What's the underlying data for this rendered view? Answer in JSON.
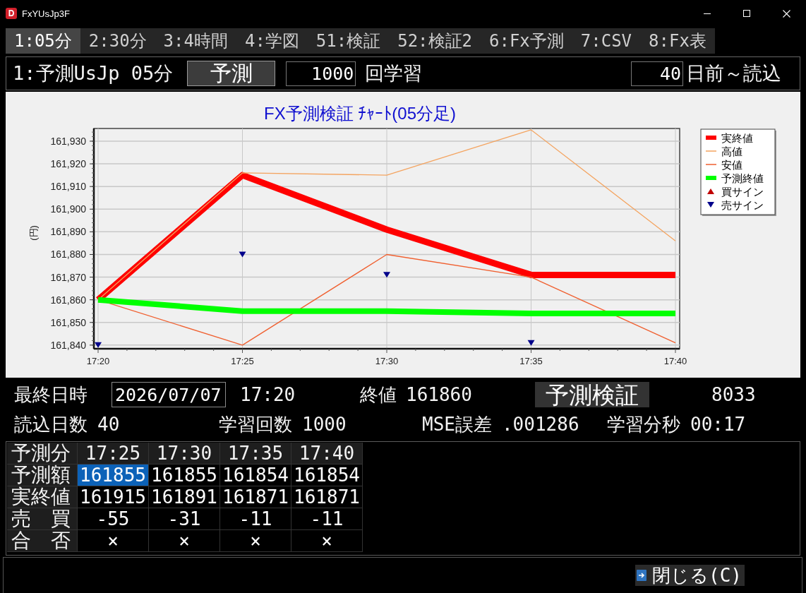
{
  "window": {
    "app_icon": "D",
    "title": "FxYUsJp3F"
  },
  "tabs": [
    {
      "label": "1:05分",
      "selected": true
    },
    {
      "label": "2:30分",
      "selected": false
    },
    {
      "label": "3:4時間",
      "selected": false
    },
    {
      "label": "4:学図",
      "selected": false
    },
    {
      "label": "51:検証",
      "selected": false
    },
    {
      "label": "52:検証2",
      "selected": false
    },
    {
      "label": "6:Fx予測",
      "selected": false
    },
    {
      "label": "7:CSV",
      "selected": false
    },
    {
      "label": "8:Fx表",
      "selected": false
    }
  ],
  "toolbar": {
    "mode": "1:予測UsJp 05分",
    "predict_button": "予測",
    "iterations": {
      "value": "1000",
      "label": "回学習"
    },
    "days": {
      "value": "40",
      "label": "日前～読込"
    }
  },
  "chart": {
    "chart_data": {
      "type": "line",
      "title": "FX予測検証 ﾁｬｰﾄ(05分足)",
      "ylabel": "(円)",
      "categories": [
        "17:20",
        "17:25",
        "17:30",
        "17:35",
        "17:40"
      ],
      "ylim": [
        161838.4,
        161935.6
      ],
      "yticks": [
        {
          "value": 161840,
          "label": "161,840"
        },
        {
          "value": 161850,
          "label": "161,850"
        },
        {
          "value": 161860,
          "label": "161,860"
        },
        {
          "value": 161870,
          "label": "161,870"
        },
        {
          "value": 161880,
          "label": "161,880"
        },
        {
          "value": 161890,
          "label": "161,890"
        },
        {
          "value": 161900,
          "label": "161,900"
        },
        {
          "value": 161910,
          "label": "161,910"
        },
        {
          "value": 161920,
          "label": "161,920"
        },
        {
          "value": 161930,
          "label": "161,930"
        }
      ],
      "grid": true,
      "legend": true,
      "series": [
        {
          "name": "実終値",
          "color": "#ff0000",
          "type": "line",
          "values": [
            161860,
            161915,
            161891,
            161871,
            161871
          ]
        },
        {
          "name": "高値",
          "color": "#f4a460",
          "type": "line",
          "values": [
            161860,
            161916,
            161915,
            161935,
            161886
          ]
        },
        {
          "name": "安値",
          "color": "#f06030",
          "type": "line",
          "values": [
            161860,
            161840,
            161880,
            161870,
            161841
          ]
        },
        {
          "name": "予測終値",
          "color": "#00ff00",
          "type": "line",
          "values": [
            161860,
            161855,
            161855,
            161854,
            161854
          ]
        },
        {
          "name": "買サイン",
          "color": "#c00000",
          "type": "scatter",
          "marker": "triangle-up",
          "values": [
            null,
            null,
            null,
            null,
            null
          ]
        },
        {
          "name": "売サイン",
          "color": "#00008b",
          "type": "scatter",
          "marker": "triangle-down",
          "values": [
            161840,
            161880,
            161871,
            161841,
            null
          ]
        }
      ]
    }
  },
  "summary": {
    "last_datetime": {
      "label": "最終日時",
      "date": "2026/07/07",
      "time": "17:20"
    },
    "close": {
      "label": "終値",
      "value": "161860"
    },
    "verify_button": "予測検証",
    "count": "8033",
    "stats": [
      {
        "label": "読込日数",
        "value": "40"
      },
      {
        "label": "学習回数",
        "value": "1000"
      },
      {
        "label": "MSE誤差",
        "value": ".001286"
      },
      {
        "label": "学習分秒",
        "value": "00:17"
      }
    ]
  },
  "forecast_table": {
    "header": {
      "label": "予測分",
      "cells": [
        "17:25",
        "17:30",
        "17:35",
        "17:40"
      ]
    },
    "rows": [
      {
        "label": "予測額",
        "cells": [
          {
            "text": "161855",
            "selected": true
          },
          {
            "text": "161855",
            "selected": false
          },
          {
            "text": "161854",
            "selected": false
          },
          {
            "text": "161854",
            "selected": false
          }
        ]
      },
      {
        "label": "実終値",
        "cells": [
          {
            "text": "161915",
            "selected": false
          },
          {
            "text": "161891",
            "selected": false
          },
          {
            "text": "161871",
            "selected": false
          },
          {
            "text": "161871",
            "selected": false
          }
        ]
      },
      {
        "label": "売　買",
        "cells": [
          {
            "text": "-55",
            "selected": false
          },
          {
            "text": "-31",
            "selected": false
          },
          {
            "text": "-11",
            "selected": false
          },
          {
            "text": "-11",
            "selected": false
          }
        ]
      },
      {
        "label": "合　否",
        "cells": [
          {
            "text": "×",
            "selected": false
          },
          {
            "text": "×",
            "selected": false
          },
          {
            "text": "×",
            "selected": false
          },
          {
            "text": "×",
            "selected": false
          }
        ]
      }
    ]
  },
  "close_button": "閉じる(C)"
}
